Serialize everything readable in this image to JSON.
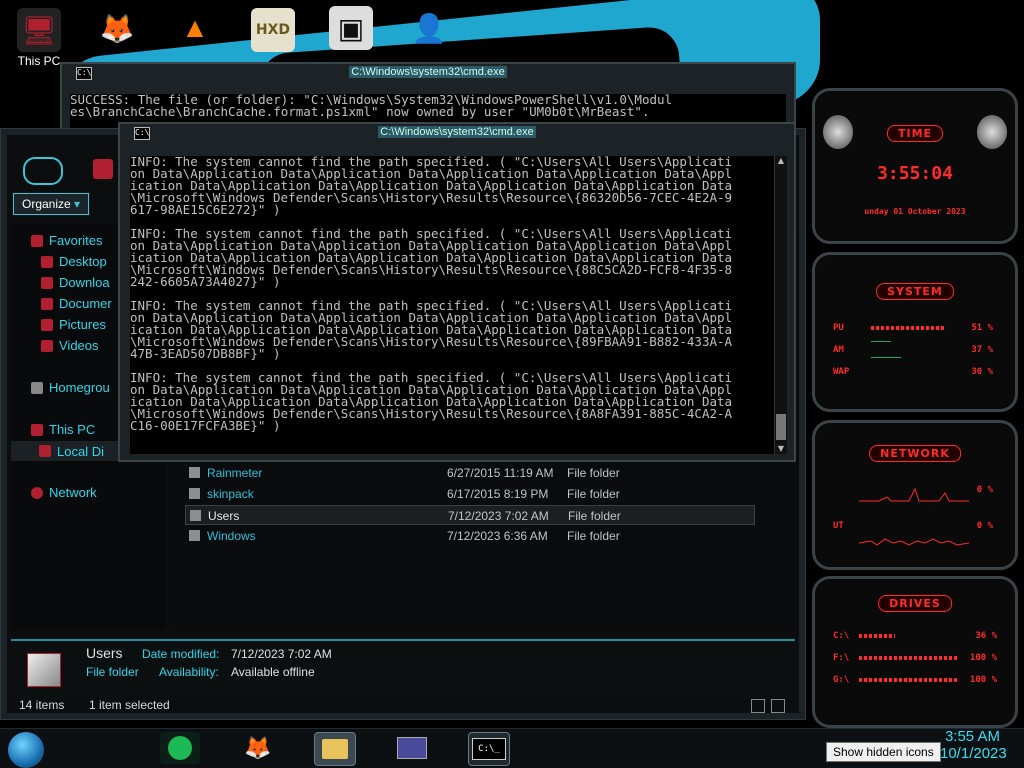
{
  "desktop": {
    "icons": [
      {
        "label": "This PC",
        "glyph": "🖥",
        "color": "#b02030"
      },
      {
        "label": "",
        "glyph": "🦊",
        "color": "#e66000"
      },
      {
        "label": "",
        "glyph": "▲",
        "color": "#ff7f00"
      },
      {
        "label": "",
        "glyph": "HXD",
        "color": "#c8b060"
      },
      {
        "label": "",
        "glyph": "▣",
        "color": "#333"
      },
      {
        "label": "",
        "glyph": "👤",
        "color": "#f2c7a0"
      }
    ]
  },
  "cmd_back": {
    "title": "C:\\Windows\\system32\\cmd.exe",
    "lines": [
      "SUCCESS: The file (or folder): \"C:\\Windows\\System32\\WindowsPowerShell\\v1.0\\Modul",
      "es\\BranchCache\\BranchCache.format.ps1xml\" now owned by user \"UM0b0t\\MrBeast\"."
    ]
  },
  "cmd_front": {
    "title": "C:\\Windows\\system32\\cmd.exe",
    "icon_text": "C:\\_",
    "lines": [
      "INFO: The system cannot find the path specified. ( \"C:\\Users\\All Users\\Applicati",
      "on Data\\Application Data\\Application Data\\Application Data\\Application Data\\Appl",
      "ication Data\\Application Data\\Application Data\\Application Data\\Application Data",
      "\\Microsoft\\Windows Defender\\Scans\\History\\Results\\Resource\\{86320D56-7CEC-4E2A-9",
      "617-98AE15C6E272}\" )",
      "",
      "INFO: The system cannot find the path specified. ( \"C:\\Users\\All Users\\Applicati",
      "on Data\\Application Data\\Application Data\\Application Data\\Application Data\\Appl",
      "ication Data\\Application Data\\Application Data\\Application Data\\Application Data",
      "\\Microsoft\\Windows Defender\\Scans\\History\\Results\\Resource\\{88C5CA2D-FCF8-4F35-8",
      "242-6605A73A4027}\" )",
      "",
      "INFO: The system cannot find the path specified. ( \"C:\\Users\\All Users\\Applicati",
      "on Data\\Application Data\\Application Data\\Application Data\\Application Data\\Appl",
      "ication Data\\Application Data\\Application Data\\Application Data\\Application Data",
      "\\Microsoft\\Windows Defender\\Scans\\History\\Results\\Resource\\{89FBAA91-B882-433A-A",
      "47B-3EAD507DB8BF}\" )",
      "",
      "INFO: The system cannot find the path specified. ( \"C:\\Users\\All Users\\Applicati",
      "on Data\\Application Data\\Application Data\\Application Data\\Application Data\\Appl",
      "ication Data\\Application Data\\Application Data\\Application Data\\Application Data",
      "\\Microsoft\\Windows Defender\\Scans\\History\\Results\\Resource\\{8A8FA391-885C-4CA2-A",
      "C16-00E17FCFA3BE}\" )"
    ]
  },
  "explorer": {
    "organize_label": "Organize",
    "nav": {
      "favorites": "Favorites",
      "desktop": "Desktop",
      "downloads": "Downloa",
      "documents": "Documer",
      "pictures": "Pictures",
      "videos": "Videos",
      "homegroup": "Homegrou",
      "this_pc": "This PC",
      "local_disk": "Local Di",
      "network": "Network"
    },
    "files": [
      {
        "name": "Rainmeter",
        "date": "6/27/2015 11:19 AM",
        "type": "File folder"
      },
      {
        "name": "skinpack",
        "date": "6/17/2015 8:19 PM",
        "type": "File folder"
      },
      {
        "name": "Users",
        "date": "7/12/2023 7:02 AM",
        "type": "File folder",
        "selected": true
      },
      {
        "name": "Windows",
        "date": "7/12/2023 6:36 AM",
        "type": "File folder"
      }
    ],
    "details": {
      "name": "Users",
      "kind": "File folder",
      "date_label": "Date modified:",
      "date_value": "7/12/2023 7:02 AM",
      "avail_label": "Availability:",
      "avail_value": "Available offline"
    },
    "status": {
      "items": "14 items",
      "selected": "1 item selected"
    }
  },
  "gadgets": {
    "time": {
      "title": "TIME",
      "clock": "3:55:04",
      "date": "unday 01 October 2023"
    },
    "system": {
      "title": "SYSTEM",
      "rows": [
        {
          "label": "PU",
          "value": "51 %",
          "level": 0.75
        },
        {
          "label": "AM",
          "value": "37 %",
          "level": 0.0
        },
        {
          "label": "WAP",
          "value": "30 %",
          "level": 0.0
        }
      ]
    },
    "network": {
      "title": "NETWORK",
      "rows": [
        {
          "label": "",
          "value": "0 %"
        },
        {
          "label": "UT",
          "value": "0 %"
        }
      ]
    },
    "drives": {
      "title": "DRIVES",
      "rows": [
        {
          "label": "C:\\",
          "value": "36 %",
          "level": 0.36
        },
        {
          "label": "F:\\",
          "value": "100 %",
          "level": 1.0
        },
        {
          "label": "G:\\",
          "value": "100 %",
          "level": 1.0
        }
      ]
    }
  },
  "taskbar": {
    "time": "3:55 AM",
    "date": "10/1/2023",
    "tooltip": "Show hidden icons",
    "cmd_icon": "C:\\_"
  }
}
